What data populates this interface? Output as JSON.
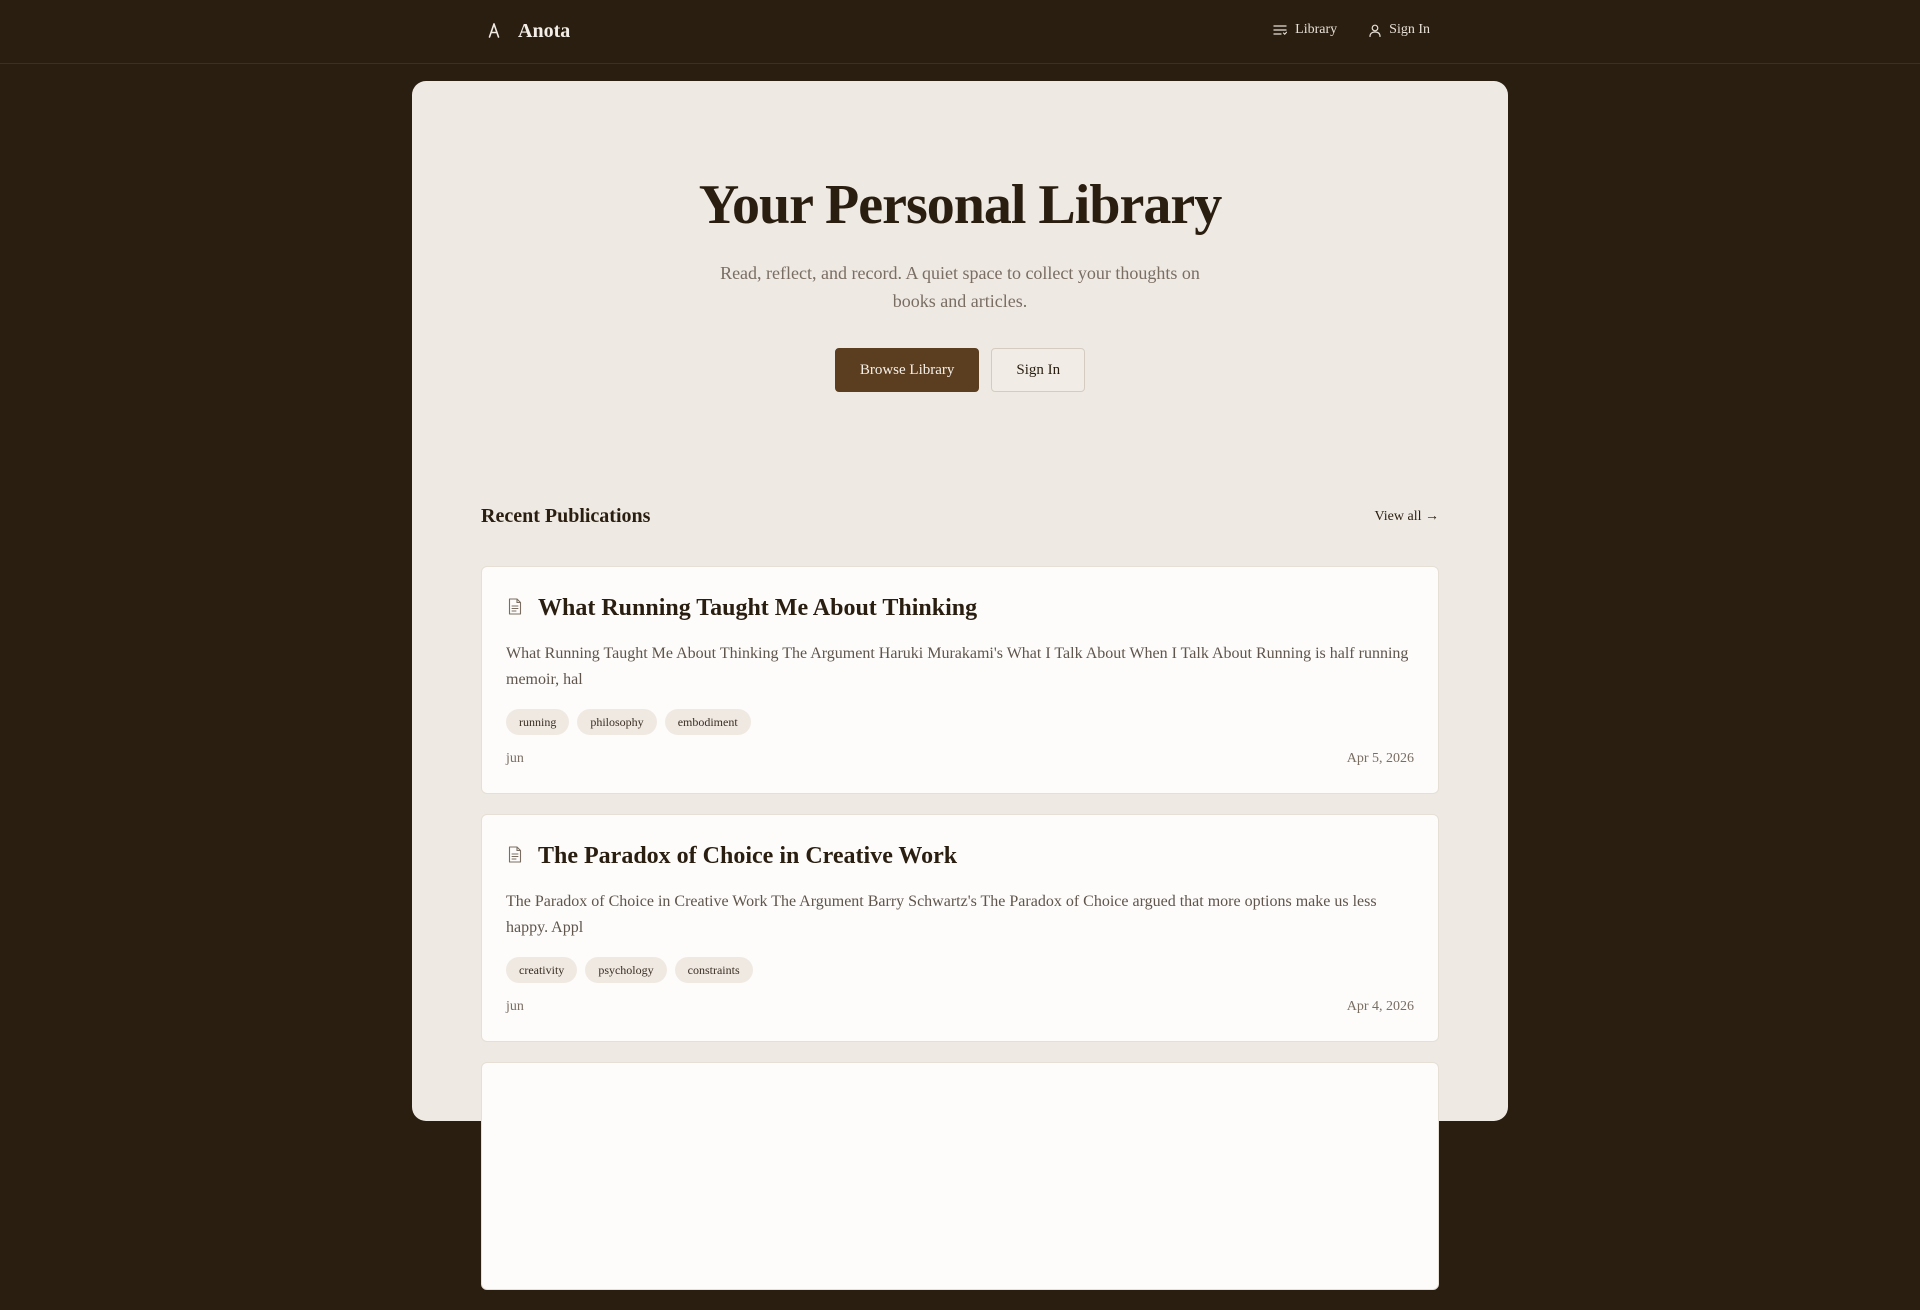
{
  "brand": {
    "name": "Anota",
    "icon": "quill-a-icon"
  },
  "nav": {
    "library_label": "Library",
    "signin_label": "Sign In"
  },
  "hero": {
    "title": "Your Personal Library",
    "subtitle": "Read, reflect, and record. A quiet space to collect your thoughts on books and articles.",
    "primary_button": "Browse Library",
    "secondary_button": "Sign In"
  },
  "recent": {
    "heading": "Recent Publications",
    "view_all": "View all →",
    "items": [
      {
        "title": "What Running Taught Me About Thinking",
        "excerpt": "What Running Taught Me About Thinking The Argument Haruki Murakami's What I Talk About When I Talk About Running is half running memoir, hal",
        "tags": [
          "running",
          "philosophy",
          "embodiment"
        ],
        "author": "jun",
        "date": "Apr 5, 2026"
      },
      {
        "title": "The Paradox of Choice in Creative Work",
        "excerpt": "The Paradox of Choice in Creative Work The Argument Barry Schwartz's The Paradox of Choice argued that more options make us less happy. Appl",
        "tags": [
          "creativity",
          "psychology",
          "constraints"
        ],
        "author": "jun",
        "date": "Apr 4, 2026"
      }
    ]
  },
  "colors": {
    "background": "#2a1e10",
    "panel": "#eee9e3",
    "card": "#fdfcfa",
    "accent": "#5b3d1f",
    "text": "#2a1e10",
    "muted": "#7a6e63"
  }
}
